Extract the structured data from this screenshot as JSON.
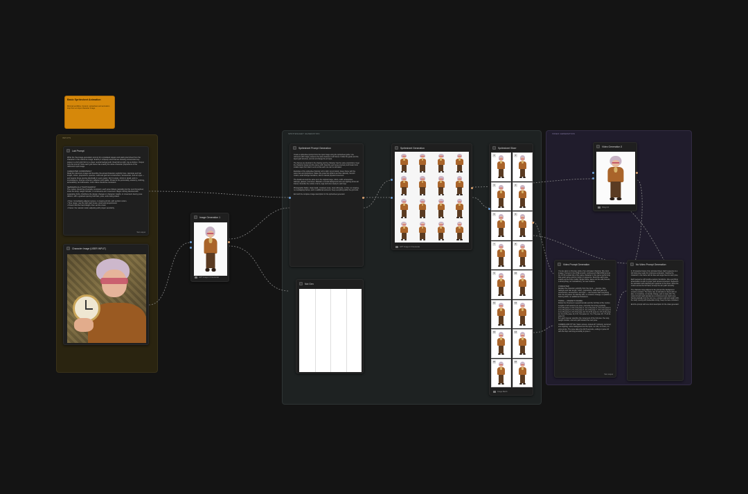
{
  "note": {
    "title": "Basic Spritesheet Animation",
    "text": "Minimal workflow. Content: spritesheet and animation loop from an input character image."
  },
  "groups": {
    "left": {
      "title": "INPUTS"
    },
    "center": {
      "title": "SPRITESHEET GENERATION"
    },
    "right": {
      "title": "VIDEO GENERATION"
    }
  },
  "nodes": {
    "lab_prompt": {
      "title": "Lab Prompt",
      "text": "Write the Yaa image-generation prompt for a pixelated square and stack pixel sheet from the character in the reference image. Exactly 4 uniquely sized frames showing consecutive key poses in a 2x2 grid (3x3 on a clean neutral background). Read left-to-right, top-to-bottom. Output only the prompt. Note each grid frame has exactly the same character proportions of the reference input image.\n\nCHARACTER CONSISTENCY\nRead the reference image and describe the actual character explicitly here. Hairstyle and hair length, colors, proportions, species, outfit and garment construction, accessories, and art style — and require those precise identically in every panel. Don't restyle, shrink in detail, and no inconsistency. Frames coherent, adjacent and stable. Preserve the personality, anatomy, clothing, accessibility, and silhouette. Color ratios should be consistent.\n\nSEAMLESS ALLY PHOTOGRAPHY\nThe motion should be physically consistent; each pose follows naturally into the next throughout; show the body, weight transfer, or continuous arm movement. Begin nothing identical with separating limbs. Distribute the design changes in character; height, or movement. Every pose distinct, with a gradual opening hold last, pose, and ending states.\n\n• Pose: Immediately adjacent poses, no looping shrink, with perfect motion.\n• Time range: use the right start boxes, sized and proportioned.\n• Poses hold the hand weight, then set the crawl.\n• Frame: the natural model, adjusting with proper sensitivity.",
      "footer": "Text output"
    },
    "character_image": {
      "title": "Character Image (USER INPUT)"
    },
    "image_generator_1": {
      "title": "Image Generation 1",
      "footer": "GPT Image 2.0 Generate"
    },
    "spritesheet_prompt": {
      "title": "Spritesheet Prompt Generation",
      "text": "Create a spritesheet prompt from the input image using the spritesheet guide. Use reference with image; preserve the same features in all frames. Follow the guide and the layout grid structure, and do not change the art style.\n\nThe frames are identical in the drawing and the character has the same proportions. Keep the character design and the same outfit. Describe each pose precisely and break it into smaller steps from start to end so that each one can be animated.\n\nExamples of the spritesheet framing; left to right, top to bottom. Every frame with the same size and proportions. Make sure poses are distinct and flow naturally. Smooth motion, avoid strange transitions, stick to natural physical movement.\n\nThe details are kept the same as in the original image; colors, outfit, accessories, hairstyle, glasses, and shoes. Maintain a neutral background and even lighting across all frames. Describe the motion of arms, legs and torso clearly in each step.\n\nPhotographic fidelity: sharp detail, consistent scale, clean silhouette, no blur, no cropping, no overlapping frames, and no additional elements. Keep everything within the grid cells.\n\nEnd with the complete image description for the spritesheet generator.",
      "footer": ""
    },
    "spritesheet_generator": {
      "title": "Spritesheet Generation",
      "footer": "GPT Image 2.0 Generate"
    },
    "not_gen": {
      "title": "Not Gen"
    },
    "spritesheet_slicer": {
      "title": "Spritesheet Slicer",
      "footer": "Image Batch",
      "badges": [
        "1",
        "2",
        "3",
        "4",
        "5",
        "6",
        "7",
        "8",
        "9",
        "10",
        "11",
        "12",
        "13",
        "14",
        "15",
        "16"
      ]
    },
    "video_generator": {
      "title": "Video Generation 3",
      "footer": "Kling 2.6"
    },
    "video_prompt": {
      "title": "Video Prompt Generation",
      "text": "You are given a 16-pose sprite of an animated character (the input image). Convert it into ONE smooth, continuous 8-SECOND prompt for a 9:16 vertical clip of the same character in the same performing that exact same-source motion in sequence. Describe each pose exactly as the 8-fps model: Single frame; leave out the edit process, In-Everything; no contradictory, no new motions.\n\nCHARACTER:\nRestate the character explicitly from the input — species, face, hairstyle and hair length, colors, proportions, outfit and garment construction, accessories, and style — and require that everything from the 16 poses. No identity drift, no costume change, no palette or framing shifts, no additional characters.\n\nTIMING — FRAME TO FRAME:\nDivide the 16 poses in equal intervals and the full flow of the motion. Lengths of all sections per pose, and write the timing explicitly.\n0.0–0.5s pose 1, 0.5–1.0s pose 2, 1.0–1.5s pose 3, 1.5–2.0s pose 4, 2.0–2.5s pose 5, 2.5–3.0s pose 6, 3.0–3.5s pose 7, 3.5–4.0s pose 8, 4.0–4.5s pose 9, 4.5–5.0s pose 10, 5.0–5.5s pose 11, 5.5–6.0s pose 12, 6.0–6.5s pose 13, 6.5–7.0s pose 14, 7.0–7.5s pose 15, 7.5–8.0s pose 16.\nFor each interval, describe the movement of the full pose: the stop, weight transfer, and arm path toward the next pose.\n\nCAMERA AND STYLE: Static camera, locked-off, full-body, centered; even lighting, same background as the input, no cuts, no zoom, no extra props. The pose takes the full 8 seconds, ending on pose 16 with the loop returning smoothly to pose 1.",
      "footer": "Text output"
    },
    "video_prompt_2": {
      "title": "No Video Prompt Generation",
      "text": "In 16 prepared steps of an animated sheet. Each sequence is a full body pose ready for continuous animation. Starting the character in the frame with its face and angle fixed to each pose.\n\nEach sequence with positive gesture transitions. Like everything all animation is with no props, and camera movement. Sequence the animation with matching arm gestures in the sheet. Show the motion across the full frame to keep the arm path smoothly.\n\nThe character stays aligned to the grid and the background remains constant. The frame rate of animation is fluent with no jitter, no morphing, no identity change, and no style drift. The output should read naturally as a continuous loop. Each pose blends gradually into the next one, a proper walk and weight shift, the body moving with believable timing. Keep the face consistent.\n\nEnd the prompt with one short description for the video generator."
    }
  },
  "colors": {
    "background": "#141414",
    "note": "#d6880a",
    "group_left": "#2a2410",
    "group_center": "#1e2222",
    "group_right": "#201c2c",
    "link": "#8a8a8a"
  }
}
